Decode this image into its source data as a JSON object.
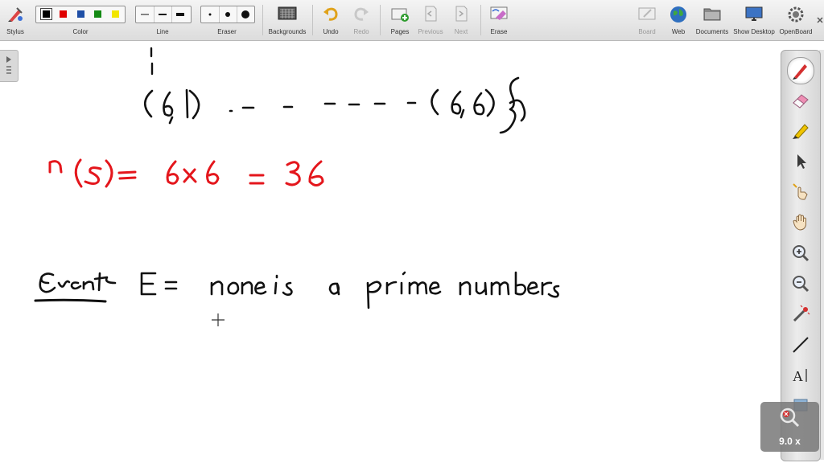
{
  "toolbar": {
    "stylus": "Stylus",
    "color": "Color",
    "line": "Line",
    "eraser": "Eraser",
    "backgrounds": "Backgrounds",
    "undo": "Undo",
    "redo": "Redo",
    "pages": "Pages",
    "previous": "Previous",
    "next": "Next",
    "erase": "Erase",
    "board": "Board",
    "web": "Web",
    "documents": "Documents",
    "show_desktop": "Show Desktop",
    "openboard": "OpenBoard",
    "colors": [
      "#000000",
      "#e00000",
      "#1f4fa6",
      "#138a13",
      "#f2e600"
    ],
    "selected_color": "#000000"
  },
  "board": {
    "line1": "(6,1)  . -  -  - - - -  (6,6)",
    "line2": "n(s) =  6 x 6  =  36",
    "line3_label": "Event",
    "line3_rest": "E =  none is a prime numbers",
    "ink_black": "#111111",
    "ink_red": "#e4161c"
  },
  "zoom": {
    "value": "9.0 x"
  },
  "palette": {
    "tools": [
      "pen-icon",
      "eraser-icon",
      "marker-icon",
      "selector-icon",
      "interactor-icon",
      "hand-icon",
      "zoom-in-icon",
      "zoom-out-icon",
      "laser-pointer-icon",
      "line-icon",
      "text-icon",
      "capture-icon"
    ],
    "text_tool": "A"
  }
}
